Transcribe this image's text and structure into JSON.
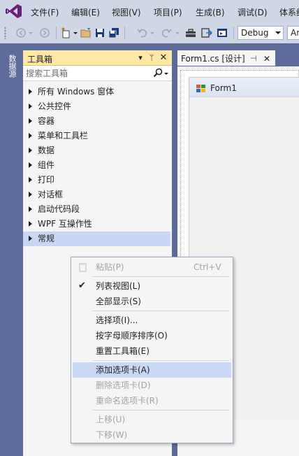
{
  "menubar": {
    "items": [
      "文件(F)",
      "编辑(E)",
      "视图(V)",
      "项目(P)",
      "生成(B)",
      "调试(D)",
      "体系结"
    ]
  },
  "toolbar": {
    "config": "Debug",
    "platform": "An"
  },
  "side_tab": {
    "label": "数据源"
  },
  "toolbox": {
    "title": "工具箱",
    "search_placeholder": "搜索工具箱",
    "groups": [
      "所有 Windows 窗体",
      "公共控件",
      "容器",
      "菜单和工具栏",
      "数据",
      "组件",
      "打印",
      "对话框",
      "启动代码段",
      "WPF 互操作性",
      "常规"
    ],
    "selected_index": 10
  },
  "document_tab": {
    "label": "Form1.cs [设计]"
  },
  "form": {
    "title": "Form1"
  },
  "context_menu": {
    "items": [
      {
        "label": "粘贴(P)",
        "shortcut": "Ctrl+V",
        "enabled": false
      },
      {
        "label": "列表视图(L)",
        "checked": true,
        "enabled": true
      },
      {
        "label": "全部显示(S)",
        "enabled": true
      },
      {
        "label": "选择项(I)...",
        "enabled": true
      },
      {
        "label": "按字母顺序排序(O)",
        "enabled": true
      },
      {
        "label": "重置工具箱(E)",
        "enabled": true
      },
      {
        "label": "添加选项卡(A)",
        "enabled": true,
        "highlighted": true
      },
      {
        "label": "删除选项卡(D)",
        "enabled": false
      },
      {
        "label": "重命名选项卡(R)",
        "enabled": false
      },
      {
        "label": "上移(U)",
        "enabled": false
      },
      {
        "label": "下移(W)",
        "enabled": false
      }
    ]
  },
  "colors": {
    "accent": "#68217a",
    "chrome": "#cfd6e5",
    "panel_header": "#ffe8a6",
    "background": "#5d6b99",
    "highlight": "#c9d8f5"
  }
}
